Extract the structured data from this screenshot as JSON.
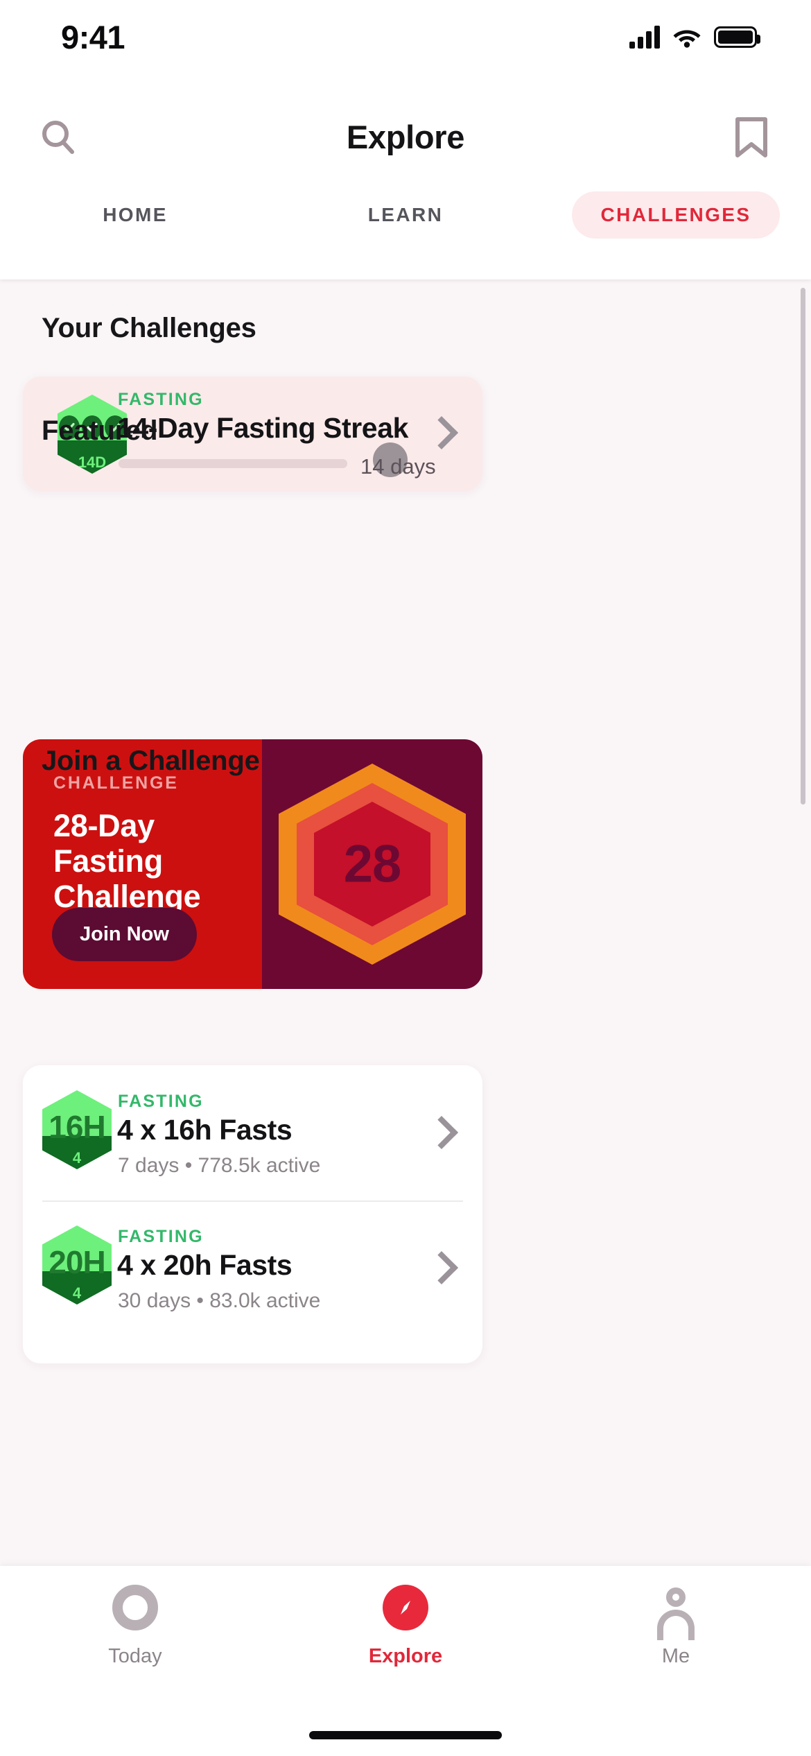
{
  "status_bar": {
    "time": "9:41",
    "icons": [
      "cellular-signal-icon",
      "wifi-icon",
      "battery-icon"
    ]
  },
  "header": {
    "title": "Explore",
    "search_icon": "search-icon",
    "bookmark_icon": "bookmark-icon"
  },
  "segments": {
    "items": [
      {
        "label": "HOME",
        "active": false
      },
      {
        "label": "LEARN",
        "active": false
      },
      {
        "label": "CHALLENGES",
        "active": true
      }
    ],
    "active_color": "#e0283a",
    "active_pill_bg": "#fdeaec",
    "inactive_color": "#55555c"
  },
  "your_challenges": {
    "section_title": "Your Challenges",
    "card": {
      "kicker": "FASTING",
      "title": "14-Day Fasting Streak",
      "badge": {
        "number": "",
        "sub": "14D",
        "type": "hex-check-badge"
      },
      "progress_label": "14 days",
      "progress_percent": 0,
      "chevron": "chevron-right-icon",
      "bg": "#fbeaea"
    }
  },
  "featured": {
    "section_title": "Featured",
    "card": {
      "kicker": "CHALLENGE",
      "title": "28-Day Fasting Challenge",
      "button_label": "Join Now",
      "medal_number": "28",
      "left_bg": "#cc1010",
      "right_bg": "#6d0833",
      "button_bg": "#5c0b33"
    }
  },
  "join_a_challenge": {
    "section_title": "Join a Challenge",
    "items": [
      {
        "kicker": "FASTING",
        "title": "4 x 16h Fasts",
        "subtitle": "7 days • 778.5k active",
        "badge_main": "16H",
        "badge_sub": "4",
        "chevron": "chevron-right-icon"
      },
      {
        "kicker": "FASTING",
        "title": "4 x 20h Fasts",
        "subtitle": "30 days • 83.0k active",
        "badge_main": "20H",
        "badge_sub": "4",
        "chevron": "chevron-right-icon"
      }
    ]
  },
  "tab_bar": {
    "items": [
      {
        "label": "Today",
        "icon": "ring-icon",
        "active": false
      },
      {
        "label": "Explore",
        "icon": "compass-icon",
        "active": true
      },
      {
        "label": "Me",
        "icon": "person-icon",
        "active": false
      }
    ],
    "active_color": "#e0283a",
    "inactive_color": "#8b858a"
  }
}
